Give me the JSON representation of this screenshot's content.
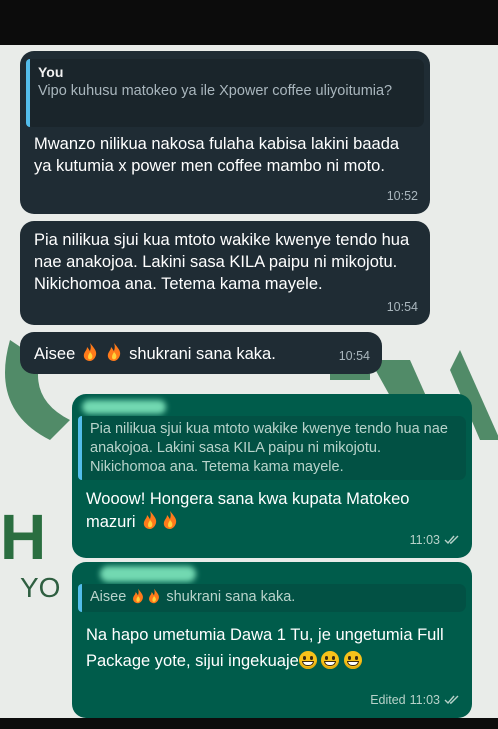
{
  "messages": [
    {
      "quote": {
        "sender": "You",
        "text": "Vipo kuhusu matokeo ya ile Xpower coffee uliyoitumia?"
      },
      "text": "Mwanzo nilikua nakosa fulaha kabisa lakini baada ya kutumia x power men coffee mambo ni moto.",
      "time": "10:52"
    },
    {
      "text": "Pia nilikua sjui kua mtoto wakike kwenye tendo hua nae anakojoa. Lakini sasa KILA paipu ni mikojotu. Nikichomoa ana. Tetema kama mayele.",
      "time": "10:54"
    },
    {
      "text_before": "Aisee",
      "text_after": "shukrani sana kaka.",
      "time": "10:54"
    },
    {
      "quote": {
        "text": "Pia nilikua sjui kua mtoto wakike kwenye tendo hua nae anakojoa. Lakini sasa KILA paipu ni mikojotu. Nikichomoa ana. Tetema kama mayele."
      },
      "text": "Wooow! Hongera sana kwa kupata Matokeo mazuri",
      "time": "11:03"
    },
    {
      "quote": {
        "text_before": "Aisee",
        "text_after": "shukrani sana kaka."
      },
      "text": "Na hapo umetumia Dawa 1 Tu, je ungetumia Full Package yote, sijui ingekuaje",
      "edited_label": "Edited",
      "time": "11:03"
    }
  ],
  "background": {
    "h_text": "H",
    "yo_text": "YO"
  },
  "colors": {
    "incoming": "#1f2c34",
    "outgoing": "#005c4b",
    "quote_bar": "#53bdeb",
    "read_ticks": "#53bdeb"
  },
  "icons": {
    "fire": "fire-emoji",
    "grin": "grinning-face-emoji",
    "ticks": "double-check-icon"
  }
}
